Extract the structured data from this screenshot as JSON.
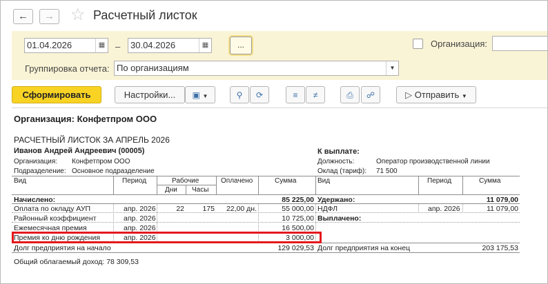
{
  "window": {
    "title": "Расчетный листок"
  },
  "icons": {
    "back": "arrow-left-icon",
    "forward": "arrow-right-icon",
    "favorite": "star-icon",
    "calendar": "calendar-icon",
    "dropdown": "chevron-down-icon"
  },
  "settings": {
    "date_from": "01.04.2026",
    "date_to": "30.04.2026",
    "dash": "–",
    "period_button": "...",
    "org_label": "Организация:",
    "grouping_label": "Группировка отчета:",
    "grouping_value": "По организациям"
  },
  "toolbar": {
    "generate": "Сформировать",
    "settings": "Настройки...",
    "send": "Отправить"
  },
  "report": {
    "org_header": "Организация: Конфетпром ООО",
    "sheet_title": "РАСЧЕТНЫЙ ЛИСТОК ЗА АПРЕЛЬ 2026",
    "employee": "Иванов Андрей Андреевич (00005)",
    "org_label": "Организация:",
    "org_value": "Конфетпром ООО",
    "dept_label": "Подразделение:",
    "dept_value": "Основное подразделение",
    "to_pay_label": "К выплате:",
    "position_label": "Должность:",
    "position_value": "Оператор производственной линии",
    "salary_label": "Оклад (тариф):",
    "salary_value": "71 500",
    "columns": {
      "kind": "Вид",
      "period": "Период",
      "working": "Рабочие",
      "days": "Дни",
      "hours": "Часы",
      "paid": "Оплачено",
      "sum": "Сумма",
      "kind2": "Вид",
      "period2": "Период",
      "sum2": "Сумма"
    },
    "accrued_label": "Начислено:",
    "accrued_total": "85 225,00",
    "withheld_label": "Удержано:",
    "withheld_total": "11 079,00",
    "accruals": [
      {
        "kind": "Оплата по окладу АУП",
        "period": "апр. 2026",
        "days": "22",
        "hours": "175",
        "paid": "22,00 дн.",
        "sum": "55 000,00"
      },
      {
        "kind": "Районный коэффициент",
        "period": "апр. 2026",
        "days": "",
        "hours": "",
        "paid": "",
        "sum": "10 725,00"
      },
      {
        "kind": "Ежемесячная премия",
        "period": "апр. 2026",
        "days": "",
        "hours": "",
        "paid": "",
        "sum": "16 500,00"
      },
      {
        "kind": "Премия ко дню рождения",
        "period": "апр. 2026",
        "days": "",
        "hours": "",
        "paid": "",
        "sum": "3 000,00"
      }
    ],
    "withholdings": [
      {
        "kind": "НДФЛ",
        "period": "апр. 2026",
        "sum": "11 079,00"
      }
    ],
    "paid_out_label": "Выплачено:",
    "debt_start_label": "Долг предприятия на начало",
    "debt_start_value": "129 029,53",
    "debt_end_label": "Долг предприятия на конец",
    "debt_end_value": "203 175,53",
    "taxable_income": "Общий облагаемый доход: 78 309,53"
  }
}
